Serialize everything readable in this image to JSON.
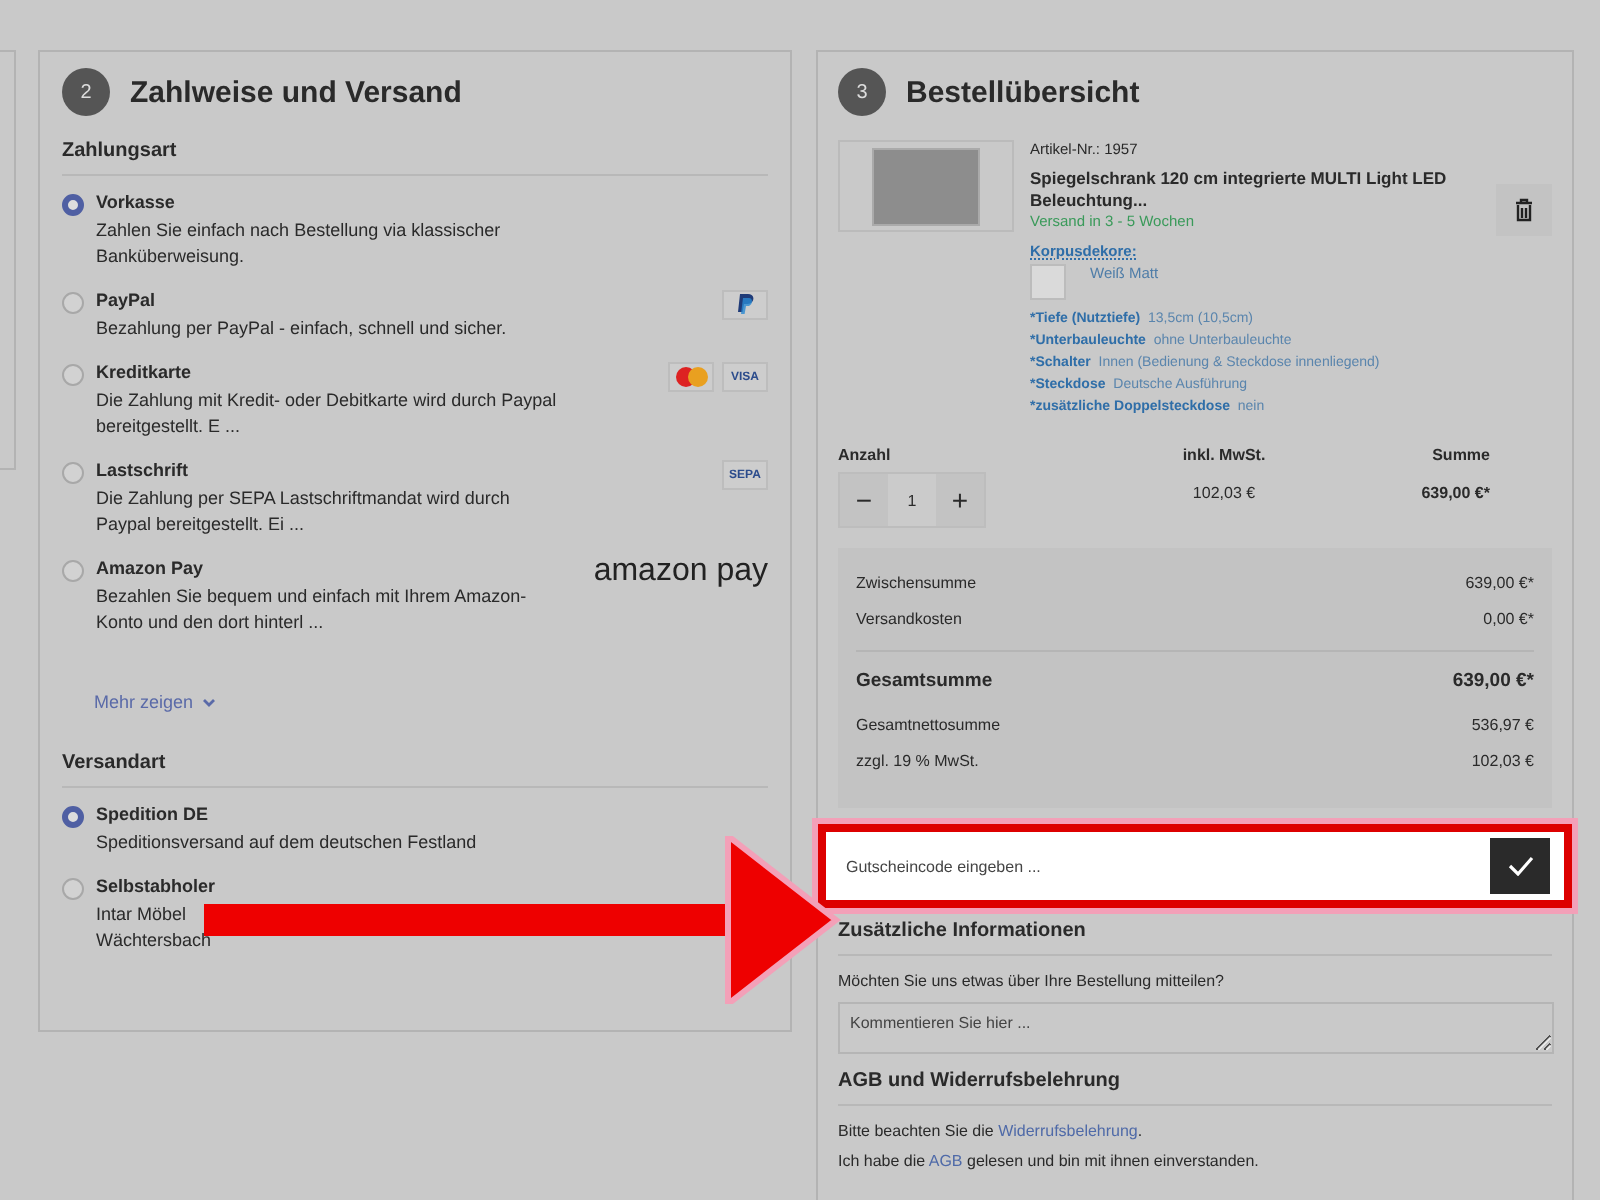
{
  "payment": {
    "step": "2",
    "title": "Zahlweise und Versand",
    "payment_heading": "Zahlungsart",
    "methods": [
      {
        "name": "Vorkasse",
        "description": "Zahlen Sie einfach nach Bestellung via klassischer Banküberweisung.",
        "selected": true
      },
      {
        "name": "PayPal",
        "description": "Bezahlung per PayPal - einfach, schnell und sicher.",
        "selected": false,
        "badges": [
          {
            "kind": "paypal"
          }
        ]
      },
      {
        "name": "Kreditkarte",
        "description": "Die Zahlung mit Kredit- oder Debitkarte wird durch Paypal bereitgestellt. E ...",
        "selected": false,
        "badges": [
          {
            "kind": "mastercard"
          },
          {
            "kind": "text",
            "text": "VISA"
          }
        ]
      },
      {
        "name": "Lastschrift",
        "description": "Die Zahlung per SEPA Lastschriftmandat wird durch Paypal bereitgestellt. Ei ...",
        "selected": false,
        "badges": [
          {
            "kind": "text",
            "text": "SEPA"
          }
        ]
      },
      {
        "name": "Amazon Pay",
        "description": "Bezahlen Sie bequem und einfach mit Ihrem Amazon-Konto und den dort hinterl ...",
        "selected": false,
        "badges": [
          {
            "kind": "amazon",
            "text": "amazon pay"
          }
        ]
      }
    ],
    "more_link": "Mehr zeigen",
    "shipping_heading": "Versandart",
    "shipping": [
      {
        "name": "Spedition DE",
        "description": "Speditionsversand auf dem deutschen Festland",
        "selected": true
      },
      {
        "name": "Selbstabholer",
        "description": "Intar Möbel",
        "description_2": "Wächtersbach",
        "selected": false
      }
    ]
  },
  "summary": {
    "step": "3",
    "title": "Bestellübersicht",
    "product": {
      "article_no": "Artikel-Nr.: 1957",
      "name": "Spiegelschrank 120 cm integrierte MULTI Light LED Beleuchtung...",
      "delivery": "Versand in 3 - 5 Wochen",
      "decor_label": "Korpusdekore:",
      "decor_value": "Weiß Matt",
      "attributes": [
        {
          "label": "*Tiefe (Nutztiefe)",
          "value": "13,5cm (10,5cm)"
        },
        {
          "label": "*Unterbauleuchte",
          "value": "ohne Unterbauleuchte"
        },
        {
          "label": "*Schalter",
          "value": "Innen (Bedienung & Steckdose innenliegend)"
        },
        {
          "label": "*Steckdose",
          "value": "Deutsche Ausführung"
        },
        {
          "label": "*zusätzliche Doppelsteckdose",
          "value": "nein"
        }
      ]
    },
    "columns": [
      "Anzahl",
      "inkl. MwSt.",
      "Summe"
    ],
    "quantity": "1",
    "minus": "−",
    "plus": "+",
    "tax": "102,03 €",
    "sum": "639,00 €*",
    "totals": [
      {
        "label": "Zwischensumme",
        "value": "639,00 €*",
        "kind": "normal"
      },
      {
        "label": "Versandkosten",
        "value": "0,00 €*",
        "kind": "normal"
      },
      {
        "label": "Gesamtsumme",
        "value": "639,00 €*",
        "kind": "total"
      },
      {
        "label": "Gesamtnettosumme",
        "value": "536,97 €",
        "kind": "normal"
      },
      {
        "label": "zzgl. 19 % MwSt.",
        "value": "102,03 €",
        "kind": "normal"
      }
    ],
    "coupon_placeholder": "Gutscheincode eingeben ...",
    "info_heading": "Zusätzliche Informationen",
    "info_question": "Möchten Sie uns etwas über Ihre Bestellung mitteilen?",
    "comment_placeholder": "Kommentieren Sie hier ...",
    "agb_heading": "AGB und Widerrufsbelehrung",
    "agb_text": "Bitte beachten Sie die",
    "agb_link": "Widerrufsbelehrung",
    "agb_text_end": ".",
    "agb_line2_start": "Ich habe die",
    "agb_line2_link": "AGB",
    "agb_line2_end": "gelesen und bin mit ihnen einverstanden."
  }
}
